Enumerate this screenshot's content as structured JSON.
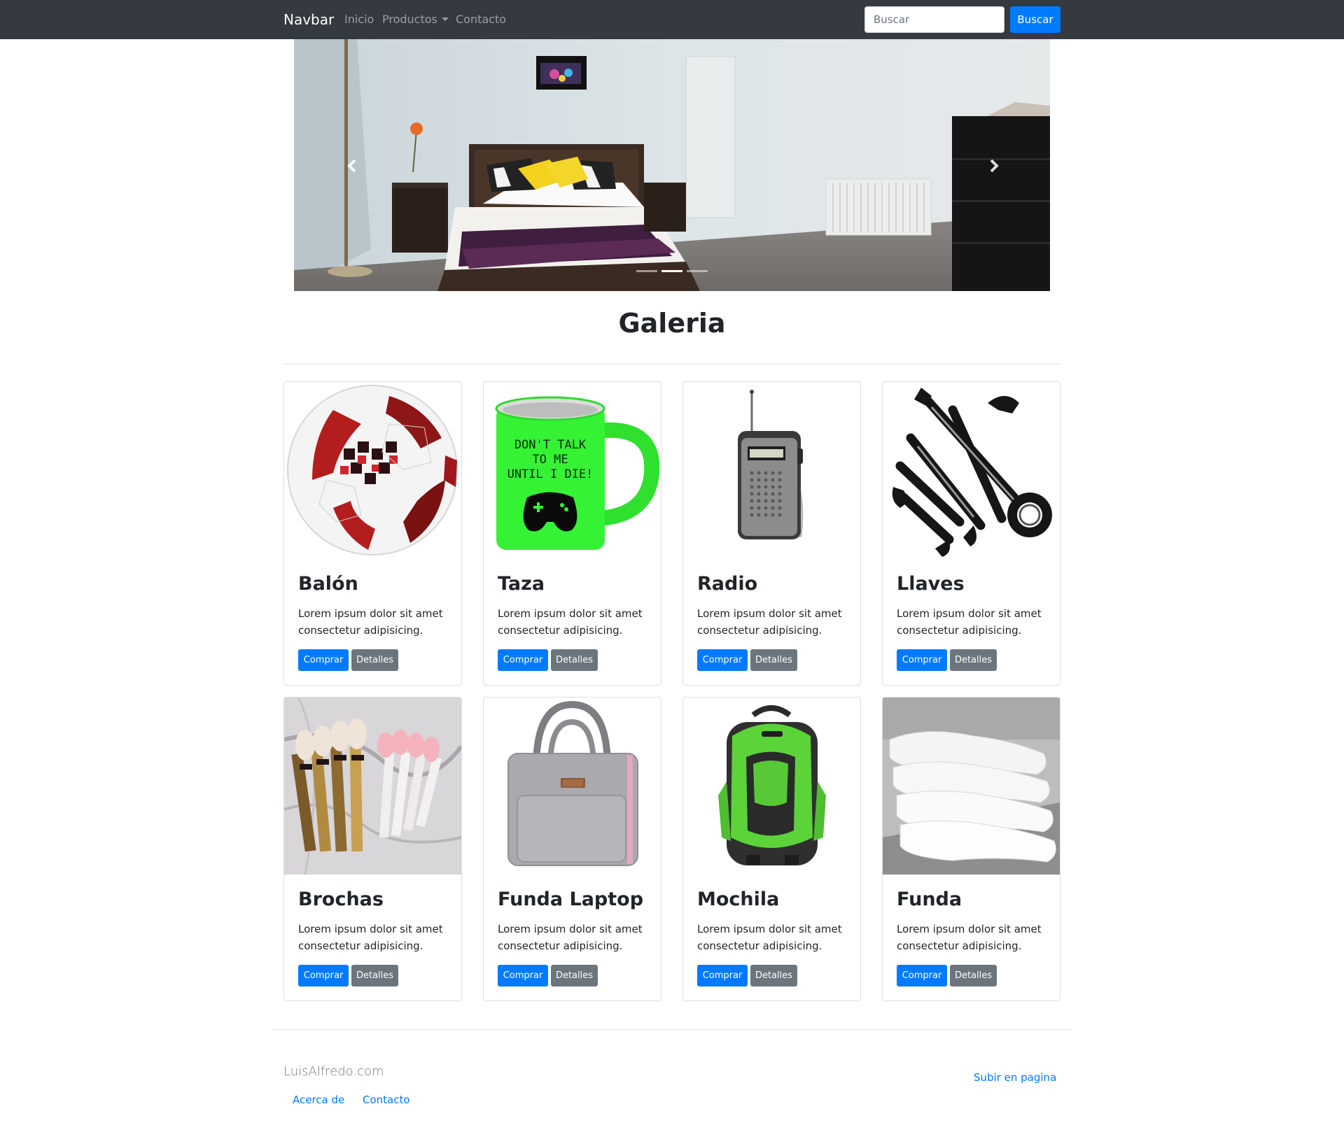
{
  "navbar": {
    "brand": "Navbar",
    "links": [
      "Inicio",
      "Productos",
      "Contacto"
    ],
    "search_placeholder": "Buscar",
    "search_button": "Buscar"
  },
  "carousel": {
    "slides": 3,
    "active_slide": 2
  },
  "gallery": {
    "title": "Galeria",
    "cards": [
      {
        "title": "Balón",
        "text": "Lorem ipsum dolor sit amet consectetur adipisicing.",
        "buy": "Comprar",
        "details": "Detalles"
      },
      {
        "title": "Taza",
        "text": "Lorem ipsum dolor sit amet consectetur adipisicing.",
        "buy": "Comprar",
        "details": "Detalles",
        "mug_text": [
          "DON'T TALK",
          "TO ME",
          "UNTIL I DIE!"
        ]
      },
      {
        "title": "Radio",
        "text": "Lorem ipsum dolor sit amet consectetur adipisicing.",
        "buy": "Comprar",
        "details": "Detalles"
      },
      {
        "title": "Llaves",
        "text": "Lorem ipsum dolor sit amet consectetur adipisicing.",
        "buy": "Comprar",
        "details": "Detalles"
      },
      {
        "title": "Brochas",
        "text": "Lorem ipsum dolor sit amet consectetur adipisicing.",
        "buy": "Comprar",
        "details": "Detalles"
      },
      {
        "title": "Funda Laptop",
        "text": "Lorem ipsum dolor sit amet consectetur adipisicing.",
        "buy": "Comprar",
        "details": "Detalles"
      },
      {
        "title": "Mochila",
        "text": "Lorem ipsum dolor sit amet consectetur adipisicing.",
        "buy": "Comprar",
        "details": "Detalles"
      },
      {
        "title": "Funda",
        "text": "Lorem ipsum dolor sit amet consectetur adipisicing.",
        "buy": "Comprar",
        "details": "Detalles"
      }
    ]
  },
  "footer": {
    "brand": "LuisAlfredo.com",
    "links": [
      "Acerca de",
      "Contacto"
    ],
    "back_to_top": "Subir en pagina"
  },
  "colors": {
    "navbar_bg": "#343a40",
    "primary": "#007bff",
    "secondary": "#6c757d"
  }
}
